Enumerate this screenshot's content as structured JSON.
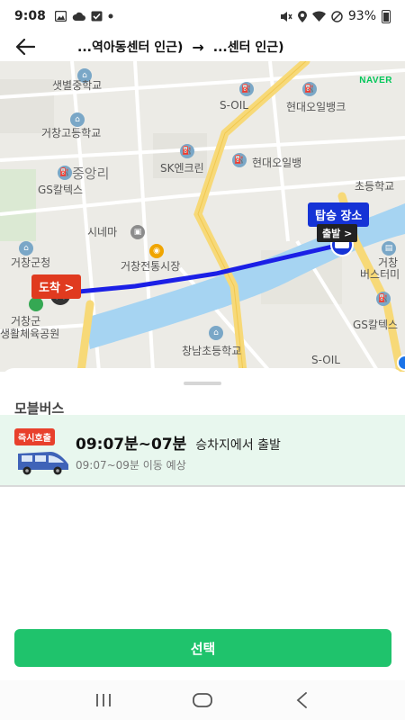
{
  "status_bar": {
    "time": "9:08",
    "battery": "93%",
    "left_icons": [
      "image-icon",
      "cloud-icon",
      "check-icon",
      "dot-icon"
    ],
    "right_icons": [
      "mute-icon",
      "location-icon",
      "wifi-icon",
      "dnd-icon",
      "battery-icon"
    ]
  },
  "header": {
    "back_icon": "back-arrow-icon",
    "origin": "...역아동센터 인근)",
    "arrow": "→",
    "destination": "...센터 인근)"
  },
  "map": {
    "watermark": "NAVER",
    "board_tag": "탑승 장소",
    "board_sub": "출발 >",
    "arrive_tag": "도착 >",
    "labels": {
      "l1": "샛별중학교",
      "l2": "거창고등학교",
      "l3": "S-OIL",
      "l4": "현대오일뱅크",
      "l5": "SK엔크린",
      "l6": "현대오일뱅",
      "l7": "중앙리",
      "l8": "GS칼텍스",
      "l9": "시네마",
      "l10": "거창전통시장",
      "l11": "거창군청",
      "l12": "초등학교",
      "l13": "거창",
      "l14": "버스터미",
      "l15": "거창군",
      "l16": "생활체육공원",
      "l17": "GS칼텍스",
      "l18": "S-OIL",
      "l19": "창남초등학교"
    },
    "route_color": "#2a1fe0"
  },
  "sheet": {
    "section_title": "모블버스",
    "option": {
      "badge": "즉시호출",
      "time_range": "09:07분~07분",
      "time_suffix": "승차지에서 출발",
      "estimate": "09:07~09분 이동 예상"
    },
    "select_label": "선택"
  },
  "nav": {
    "recent_icon": "recent-apps-icon",
    "home_icon": "home-icon",
    "back_icon": "nav-back-icon"
  }
}
